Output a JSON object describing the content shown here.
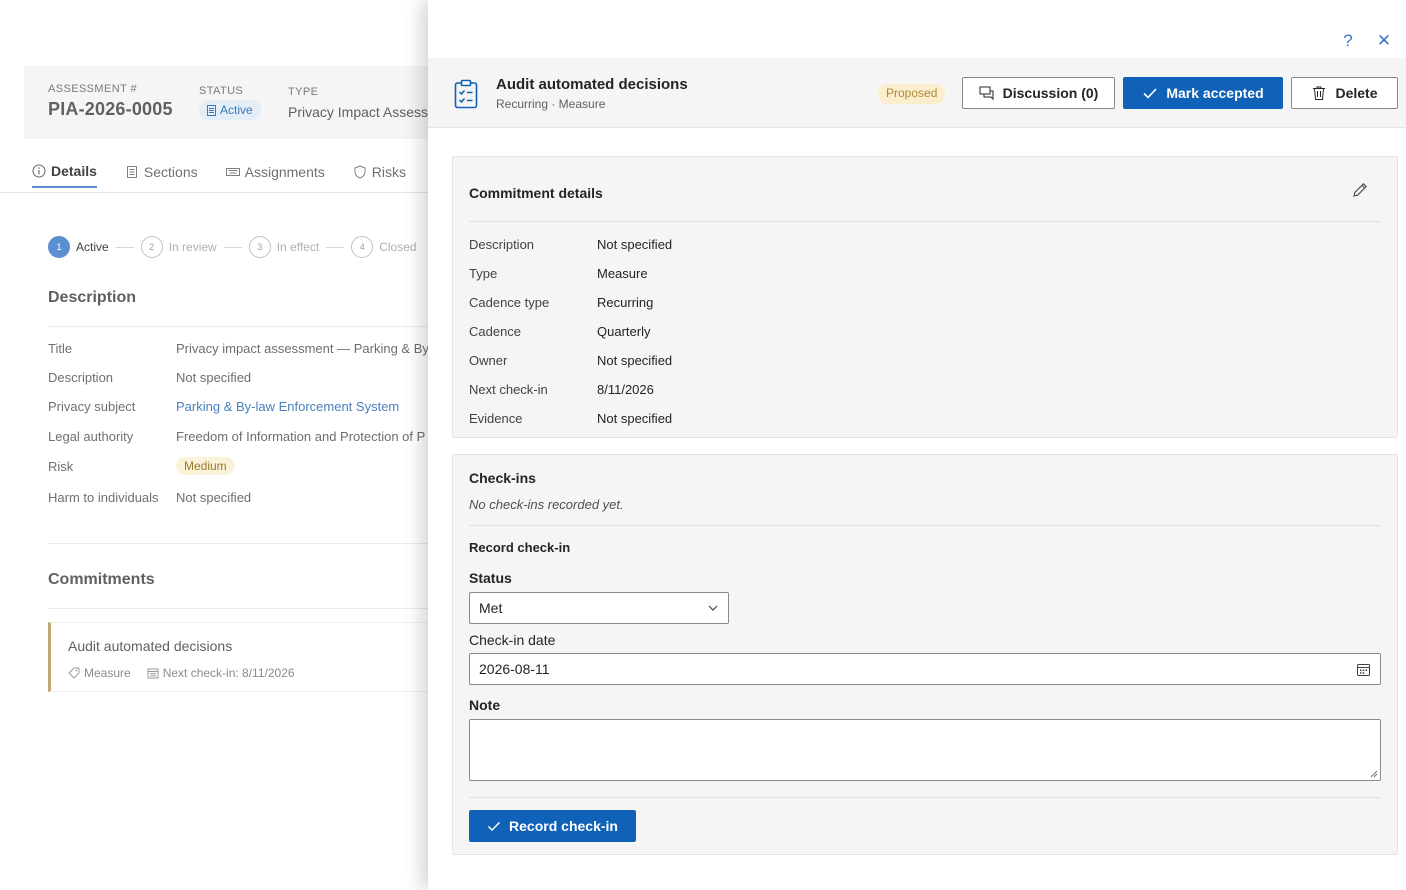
{
  "background": {
    "assessment_label": "ASSESSMENT #",
    "assessment_id": "PIA-2026-0005",
    "status_label": "STATUS",
    "status_value": "Active",
    "type_label": "TYPE",
    "type_value": "Privacy Impact Assess",
    "tabs": [
      {
        "label": "Details",
        "icon": "info-icon"
      },
      {
        "label": "Sections",
        "icon": "document-icon"
      },
      {
        "label": "Assignments",
        "icon": "keyboard-icon"
      },
      {
        "label": "Risks",
        "icon": "shield-icon"
      }
    ],
    "stepper": [
      {
        "num": "1",
        "label": "Active"
      },
      {
        "num": "2",
        "label": "In review"
      },
      {
        "num": "3",
        "label": "In effect"
      },
      {
        "num": "4",
        "label": "Closed"
      }
    ],
    "description_title": "Description",
    "fields": [
      {
        "key": "Title",
        "value": "Privacy impact assessment — Parking & By-"
      },
      {
        "key": "Description",
        "value": "Not specified"
      },
      {
        "key": "Privacy subject",
        "value": "Parking & By-law Enforcement System"
      },
      {
        "key": "Legal authority",
        "value": "Freedom of Information and Protection of P"
      },
      {
        "key": "Risk",
        "value": "Medium"
      },
      {
        "key": "Harm to individuals",
        "value": "Not specified"
      }
    ],
    "commitments_title": "Commitments",
    "commitment": {
      "title": "Audit automated decisions",
      "type": "Measure",
      "next_checkin": "Next check-in: 8/11/2026"
    }
  },
  "drawer": {
    "help_icon": "?",
    "close_icon": "✕",
    "title": "Audit automated decisions",
    "subtitle": "Recurring · Measure",
    "badge": "Proposed",
    "buttons": {
      "discussion": "Discussion (0)",
      "accept": "Mark accepted",
      "delete": "Delete"
    },
    "details": {
      "title": "Commitment details",
      "rows": [
        {
          "key": "Description",
          "value": "Not specified"
        },
        {
          "key": "Type",
          "value": "Measure"
        },
        {
          "key": "Cadence type",
          "value": "Recurring"
        },
        {
          "key": "Cadence",
          "value": "Quarterly"
        },
        {
          "key": "Owner",
          "value": "Not specified"
        },
        {
          "key": "Next check-in",
          "value": "8/11/2026"
        },
        {
          "key": "Evidence",
          "value": "Not specified"
        }
      ]
    },
    "checkins": {
      "title": "Check-ins",
      "empty": "No check-ins recorded yet.",
      "record_title": "Record check-in",
      "status_label": "Status",
      "status_value": "Met",
      "date_label": "Check-in date",
      "date_value": "2026-08-11",
      "note_label": "Note",
      "note_value": "",
      "record_button": "Record check-in"
    }
  },
  "colors": {
    "primary": "#0f62b8",
    "badge_proposed": "#fbeecc",
    "badge_medium": "#fbf2da",
    "accent_border": "#c2a878"
  }
}
